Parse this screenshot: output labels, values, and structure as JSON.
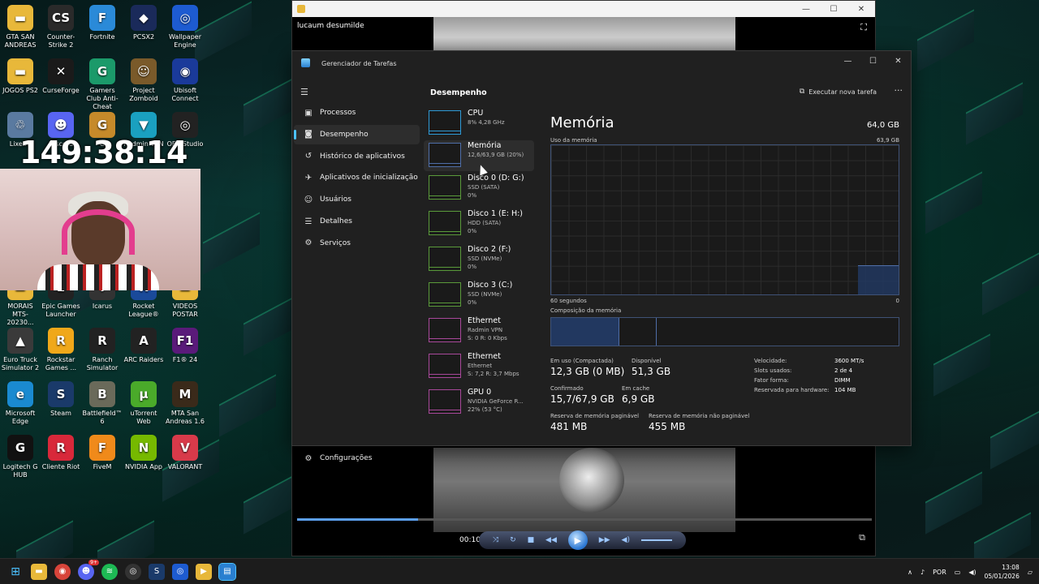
{
  "desktop": {
    "icons": [
      {
        "label": "GTA SAN ANDREAS",
        "color": "#e8b83a",
        "glyph": "▬"
      },
      {
        "label": "Counter-Strike 2",
        "color": "#2a2a2a",
        "glyph": "CS"
      },
      {
        "label": "Fortnite",
        "color": "#2a8ad8",
        "glyph": "F"
      },
      {
        "label": "PCSX2",
        "color": "#1a2a5a",
        "glyph": "◆"
      },
      {
        "label": "Wallpaper Engine",
        "color": "#1d5bd1",
        "glyph": "◎"
      },
      {
        "label": "JOGOS PS2",
        "color": "#e8b83a",
        "glyph": "▬"
      },
      {
        "label": "CurseForge",
        "color": "#1a1a1a",
        "glyph": "✕"
      },
      {
        "label": "Gamers Club Anti-Cheat",
        "color": "#1b9a6a",
        "glyph": "G"
      },
      {
        "label": "Project Zomboid",
        "color": "#7a5a2a",
        "glyph": "☺"
      },
      {
        "label": "Ubisoft Connect",
        "color": "#1a3a9a",
        "glyph": "◉"
      },
      {
        "label": "Lixeira",
        "color": "#5a7aa0",
        "glyph": "♲"
      },
      {
        "label": "Discord",
        "color": "#5865f2",
        "glyph": "☻"
      },
      {
        "label": "G",
        "color": "#c68a2a",
        "glyph": "G"
      },
      {
        "label": "Radmin VPN",
        "color": "#1aa0c0",
        "glyph": "▼"
      },
      {
        "label": "OBS Studio",
        "color": "#222",
        "glyph": "◎"
      },
      {
        "label": "MORAIS MTS-20230...",
        "color": "#e8b83a",
        "glyph": "▬"
      },
      {
        "label": "Epic Games Launcher",
        "color": "#222",
        "glyph": "E"
      },
      {
        "label": "Icarus",
        "color": "#333",
        "glyph": "I"
      },
      {
        "label": "Rocket League®",
        "color": "#1a4a9a",
        "glyph": "R"
      },
      {
        "label": "VIDEOS POSTAR",
        "color": "#e8b83a",
        "glyph": "▬"
      },
      {
        "label": "Euro Truck Simulator 2",
        "color": "#3a3a3a",
        "glyph": "▲"
      },
      {
        "label": "Rockstar Games ...",
        "color": "#f0a81a",
        "glyph": "R"
      },
      {
        "label": "Ranch Simulator",
        "color": "#222",
        "glyph": "R"
      },
      {
        "label": "ARC Raiders",
        "color": "#222",
        "glyph": "A"
      },
      {
        "label": "F1® 24",
        "color": "#5a1a7a",
        "glyph": "F1"
      },
      {
        "label": "Microsoft Edge",
        "color": "#1a8ad0",
        "glyph": "e"
      },
      {
        "label": "Steam",
        "color": "#1a3a6a",
        "glyph": "S"
      },
      {
        "label": "Battlefield™ 6",
        "color": "#6a6a5a",
        "glyph": "B"
      },
      {
        "label": "uTorrent Web",
        "color": "#4aaa2a",
        "glyph": "µ"
      },
      {
        "label": "MTA San Andreas 1.6",
        "color": "#3a2a1a",
        "glyph": "M"
      },
      {
        "label": "Logitech G HUB",
        "color": "#111",
        "glyph": "G"
      },
      {
        "label": "Cliente Riot",
        "color": "#d8283a",
        "glyph": "R"
      },
      {
        "label": "FiveM",
        "color": "#f08a1a",
        "glyph": "F"
      },
      {
        "label": "NVIDIA App",
        "color": "#76b900",
        "glyph": "N"
      },
      {
        "label": "VALORANT",
        "color": "#d83a4a",
        "glyph": "V"
      }
    ],
    "timer": "149:38:14"
  },
  "player": {
    "video_name": "lucaum desumilde",
    "time": "00:10",
    "progress": 0.21
  },
  "task_manager": {
    "title": "Gerenciador de Tarefas",
    "section": "Desempenho",
    "new_task": "Executar nova tarefa",
    "nav": [
      {
        "label": "Processos",
        "icon": "processes-icon",
        "glyph": "▣"
      },
      {
        "label": "Desempenho",
        "icon": "performance-icon",
        "glyph": "◙",
        "active": true
      },
      {
        "label": "Histórico de aplicativos",
        "icon": "history-icon",
        "glyph": "↺"
      },
      {
        "label": "Aplicativos de inicialização",
        "icon": "startup-icon",
        "glyph": "✈"
      },
      {
        "label": "Usuários",
        "icon": "users-icon",
        "glyph": "☺"
      },
      {
        "label": "Detalhes",
        "icon": "details-icon",
        "glyph": "☰"
      },
      {
        "label": "Serviços",
        "icon": "services-icon",
        "glyph": "⚙"
      }
    ],
    "settings_label": "Configurações",
    "resources": [
      {
        "name": "CPU",
        "l2": "8% 4,28 GHz",
        "l3": "",
        "color": "#2e9ad6"
      },
      {
        "name": "Memória",
        "l2": "12,6/63,9 GB (20%)",
        "l3": "",
        "color": "#4f6ea8",
        "active": true
      },
      {
        "name": "Disco 0 (D: G:)",
        "l2": "SSD (SATA)",
        "l3": "0%",
        "color": "#5a9a3a"
      },
      {
        "name": "Disco 1 (E: H:)",
        "l2": "HDD (SATA)",
        "l3": "0%",
        "color": "#5a9a3a"
      },
      {
        "name": "Disco 2 (F:)",
        "l2": "SSD (NVMe)",
        "l3": "0%",
        "color": "#5a9a3a"
      },
      {
        "name": "Disco 3 (C:)",
        "l2": "SSD (NVMe)",
        "l3": "0%",
        "color": "#5a9a3a"
      },
      {
        "name": "Ethernet",
        "l2": "Radmin VPN",
        "l3": "S: 0 R: 0 Kbps",
        "color": "#a8489a"
      },
      {
        "name": "Ethernet",
        "l2": "Ethernet",
        "l3": "S: 7,2 R: 3,7 Mbps",
        "color": "#a8489a"
      },
      {
        "name": "GPU 0",
        "l2": "NVIDIA GeForce R...",
        "l3": "22% (53 °C)",
        "color": "#a8489a"
      }
    ],
    "memory": {
      "title": "Memória",
      "total": "64,0 GB",
      "usage_label": "Uso da memória",
      "usage_max": "63,9 GB",
      "x_left": "60 segundos",
      "x_right": "0",
      "composition_label": "Composição da memória",
      "stats": [
        {
          "label": "Em uso (Compactada)",
          "value": "12,3 GB (0 MB)"
        },
        {
          "label": "Disponível",
          "value": "51,3 GB"
        },
        {
          "label": "Confirmado",
          "value": "15,7/67,9 GB"
        },
        {
          "label": "Em cache",
          "value": "6,9 GB"
        },
        {
          "label": "Reserva de memória paginável",
          "value": "481 MB"
        },
        {
          "label": "Reserva de memória não paginável",
          "value": "455 MB"
        }
      ],
      "specs": [
        {
          "k": "Velocidade:",
          "v": "3600 MT/s"
        },
        {
          "k": "Slots usados:",
          "v": "2 de 4"
        },
        {
          "k": "Fator forma:",
          "v": "DIMM"
        },
        {
          "k": "Reservada para hardware:",
          "v": "104 MB"
        }
      ]
    }
  },
  "taskbar": {
    "lang": "POR",
    "time": "13:08",
    "date": "05/01/2026",
    "discord_badge": "9+"
  }
}
